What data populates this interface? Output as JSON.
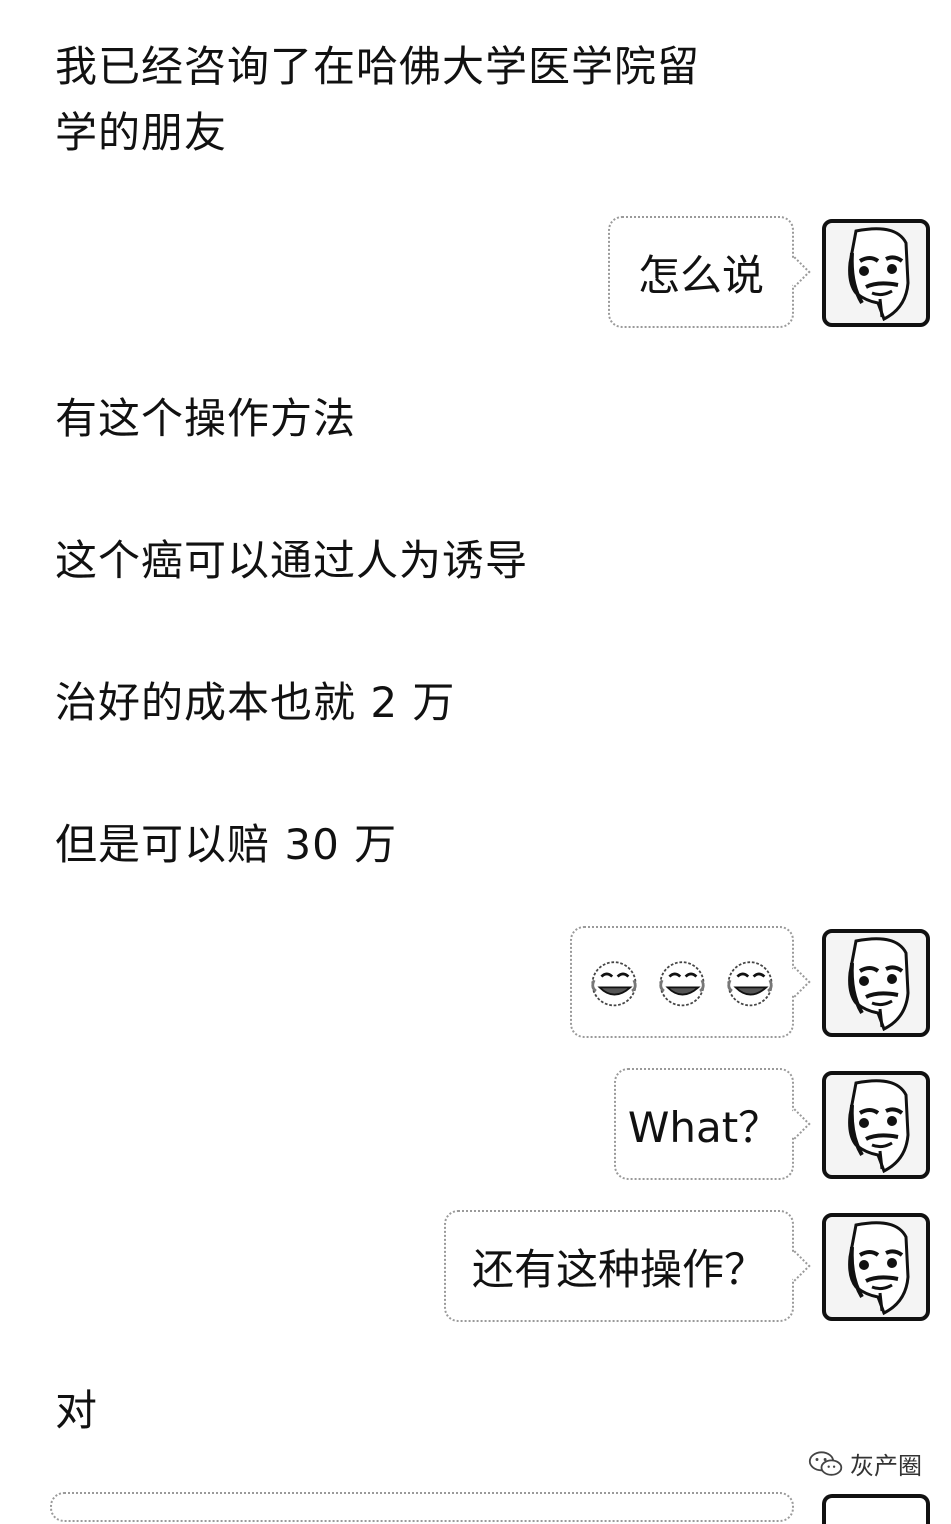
{
  "chat": {
    "messages": [
      {
        "side": "left",
        "text": "我已经咨询了在哈佛大学医学院留\n学的朋友"
      },
      {
        "side": "right",
        "text": "怎么说"
      },
      {
        "side": "left",
        "text": "有这个操作方法"
      },
      {
        "side": "left",
        "text": "这个癌可以通过人为诱导"
      },
      {
        "side": "left",
        "text": "治好的成本也就 2 万"
      },
      {
        "side": "left",
        "text": "但是可以赔 30 万"
      },
      {
        "side": "right",
        "type": "emoji",
        "icons": [
          "laugh-cry-icon",
          "laugh-cry-icon",
          "laugh-cry-icon"
        ]
      },
      {
        "side": "right",
        "text": "What？"
      },
      {
        "side": "right",
        "text": "还有这种操作？"
      },
      {
        "side": "left",
        "text": "对"
      }
    ]
  },
  "avatar": {
    "icon": "guy-fawkes-mask-icon"
  },
  "watermark": {
    "icon": "wechat-icon",
    "text": "灰产圈"
  }
}
